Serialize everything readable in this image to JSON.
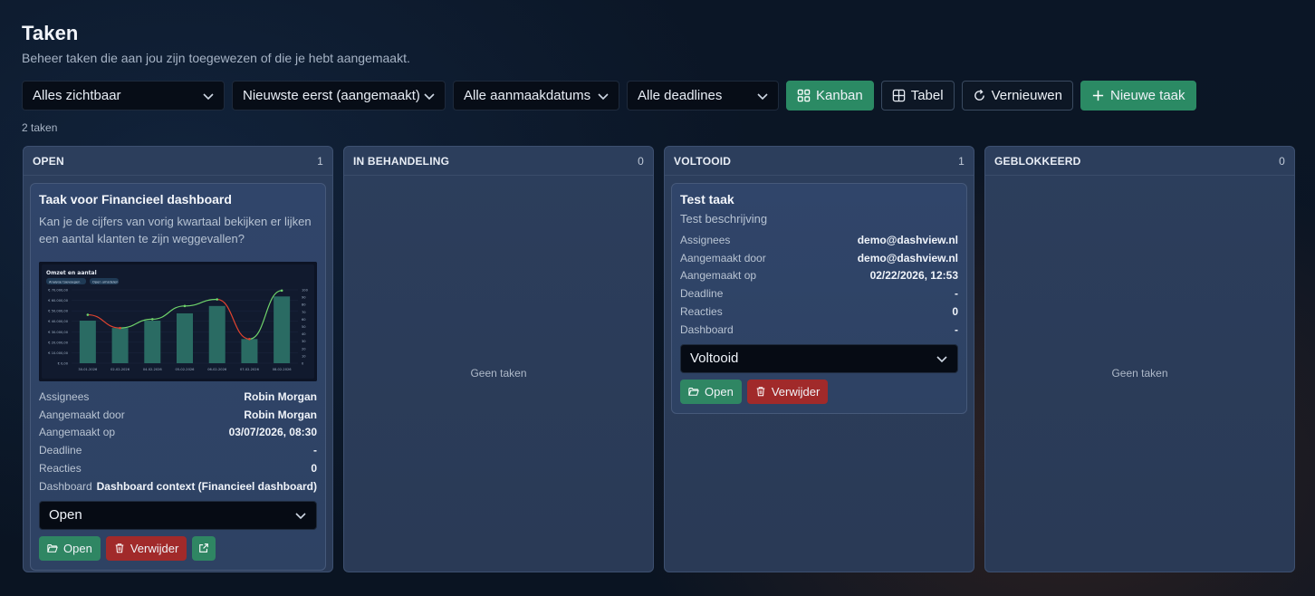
{
  "page": {
    "title": "Taken",
    "subtitle": "Beheer taken die aan jou zijn toegewezen of die je hebt aangemaakt."
  },
  "toolbar": {
    "visibility_filter": "Alles zichtbaar",
    "sort": "Nieuwste eerst (aangemaakt)",
    "created_filter": "Alle aanmaakdatums",
    "deadline_filter": "Alle deadlines",
    "kanban_label": "Kanban",
    "table_label": "Tabel",
    "refresh_label": "Vernieuwen",
    "new_task_label": "Nieuwe taak"
  },
  "task_count": "2 taken",
  "meta_labels": {
    "assignees": "Assignees",
    "created_by": "Aangemaakt door",
    "created_at": "Aangemaakt op",
    "deadline": "Deadline",
    "reactions": "Reacties",
    "dashboard": "Dashboard"
  },
  "actions": {
    "open": "Open",
    "delete": "Verwijder"
  },
  "columns": [
    {
      "title": "OPEN",
      "count": "1"
    },
    {
      "title": "IN BEHANDELING",
      "count": "0",
      "empty_text": "Geen taken"
    },
    {
      "title": "VOLTOOID",
      "count": "1"
    },
    {
      "title": "GEBLOKKEERD",
      "count": "0",
      "empty_text": "Geen taken"
    }
  ],
  "cards": [
    {
      "title": "Taak voor Financieel dashboard",
      "description": "Kan je de cijfers van vorig kwartaal bekijken er lijken een aantal klanten te zijn weggevallen?",
      "assignees": "Robin Morgan",
      "created_by": "Robin Morgan",
      "created_at": "03/07/2026, 08:30",
      "deadline": "-",
      "reactions": "0",
      "dashboard": "Dashboard context (Financieel dashboard)",
      "status": "Open",
      "thumbnail": {
        "title": "Omzet en aantal",
        "chip1": "Analyse toevoegen",
        "chip2": "Open umsdelen",
        "y_ticks": [
          "€ 70.000,00",
          "€ 60.000,00",
          "€ 50.000,00",
          "€ 40.000,00",
          "€ 30.000,00",
          "€ 20.000,00",
          "€ 10.000,00",
          "€ 0,00"
        ],
        "y2_ticks": [
          "100",
          "90",
          "80",
          "70",
          "60",
          "50",
          "40",
          "30",
          "20",
          "10",
          "0"
        ],
        "x_ticks": [
          "30-01-2026",
          "02-02-2026",
          "04-02-2026",
          "05-02-2026",
          "06-02-2026",
          "07-02-2026",
          "08-02-2026"
        ],
        "colors": {
          "bar": "#2a6b63",
          "line_up": "#6fd36b",
          "line_down": "#e0432f"
        }
      }
    },
    {
      "title": "Test taak",
      "description": "Test beschrijving",
      "assignees": "demo@dashview.nl",
      "created_by": "demo@dashview.nl",
      "created_at": "02/22/2026, 12:53",
      "deadline": "-",
      "reactions": "0",
      "dashboard": "-",
      "status": "Voltooid"
    }
  ]
}
